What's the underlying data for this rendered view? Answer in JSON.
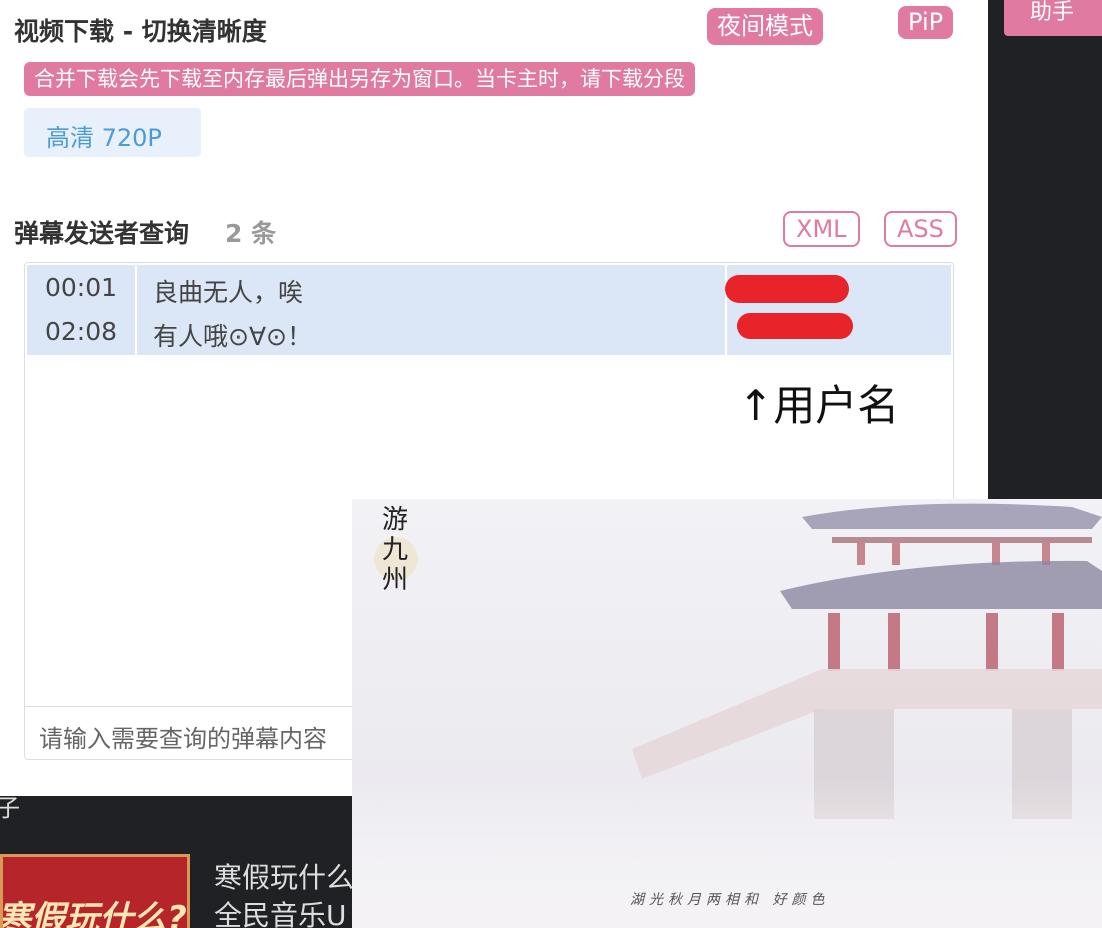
{
  "sidebar": {
    "help_label": "助手"
  },
  "download": {
    "title": "视频下载 - 切换清晰度",
    "night_mode": "夜间模式",
    "pip": "PiP",
    "warning": "合并下载会先下载至内存最后弹出另存为窗口。当卡主时，请下载分段",
    "quality": "高清 720P"
  },
  "danmaku": {
    "title": "弹幕发送者查询",
    "count": "2 条",
    "xml": "XML",
    "ass": "ASS",
    "rows": [
      {
        "time": "00:01",
        "text": "良曲无人，唉"
      },
      {
        "time": "02:08",
        "text": "有人哦⊙∀⊙！"
      }
    ],
    "username_hint": "↑用户名",
    "search_placeholder": "请输入需要查询的弹幕内容"
  },
  "background": {
    "fragment": "子",
    "headline1": "寒假玩什么",
    "headline2": "全民音乐U",
    "promo": "寒假玩什么?"
  },
  "overlay_image": {
    "logo": "游九州",
    "caption": "湖光秋月两相和 好颜色"
  },
  "colors": {
    "accent": "#e07aa0",
    "row_bg": "#dbe7f6",
    "quality_text": "#4c9bd8"
  }
}
